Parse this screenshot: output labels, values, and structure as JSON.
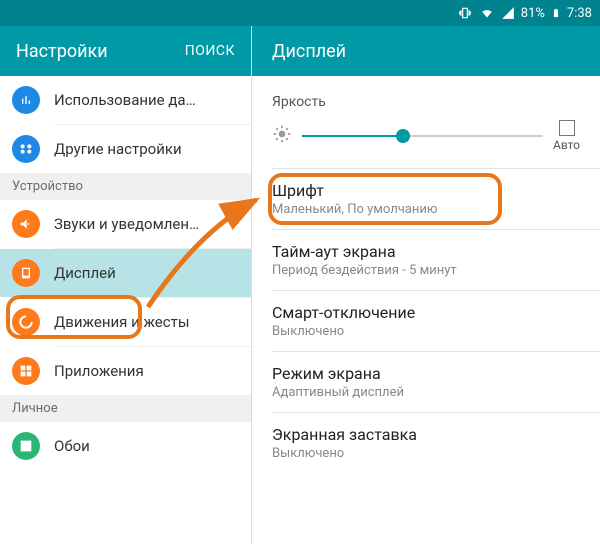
{
  "status": {
    "battery": "81%",
    "time": "7:38"
  },
  "left": {
    "title": "Настройки",
    "search": "ПОИСК",
    "sections": {
      "device": "Устройство",
      "personal": "Личное"
    },
    "items": {
      "data_usage": "Использование да…",
      "more": "Другие настройки",
      "sounds": "Звуки и уведомлен…",
      "display": "Дисплей",
      "motion": "Движения и жесты",
      "apps": "Приложения",
      "wallpaper": "Обои"
    }
  },
  "right": {
    "title": "Дисплей",
    "brightness_label": "Яркость",
    "auto_label": "Авто",
    "font": {
      "title": "Шрифт",
      "sub": "Маленький, По умолчанию"
    },
    "timeout": {
      "title": "Тайм-аут экрана",
      "sub": "Период бездействия - 5 минут"
    },
    "smart": {
      "title": "Смарт-отключение",
      "sub": "Выключено"
    },
    "mode": {
      "title": "Режим экрана",
      "sub": "Адаптивный дисплей"
    },
    "saver": {
      "title": "Экранная заставка",
      "sub": "Выключено"
    }
  }
}
